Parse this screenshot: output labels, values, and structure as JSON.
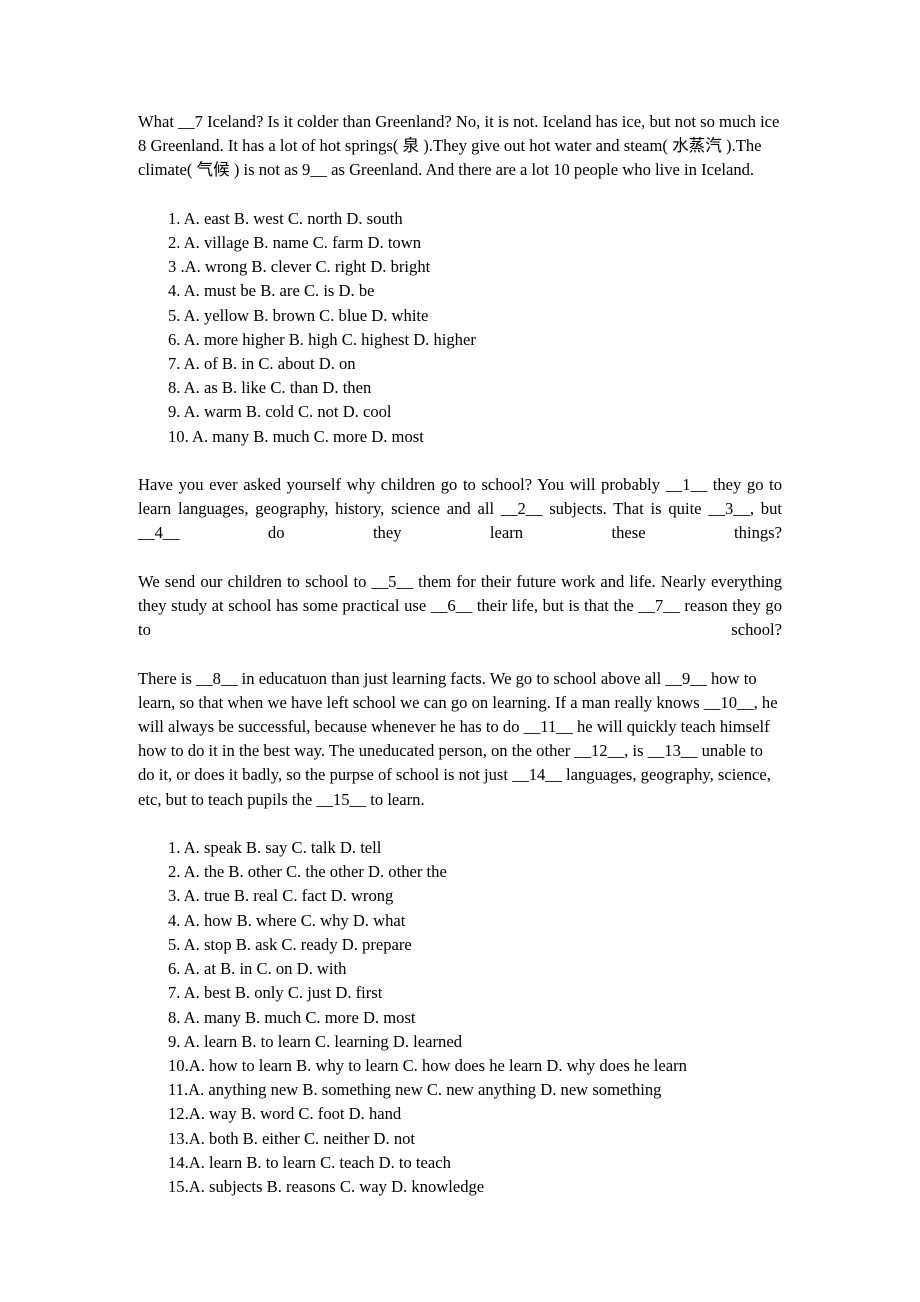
{
  "document": {
    "type": "english-cloze-worksheet",
    "page_background": "#ffffff",
    "text_color": "#000000"
  },
  "passage1": {
    "lines": [
      "What __7 Iceland? Is it colder than Greenland? No, it is not. Iceland has ice, but not so much ice 8 Greenland. It has a lot of hot springs( 泉 ).They give out hot water and steam( 水蒸汽 ).The climate( 气候 ) is not as 9__ as Greenland. And there are a lot 10 people who live in Iceland."
    ],
    "full_text": "What __7 Iceland? Is it colder than Greenland? No, it is not. Iceland has ice, but not so much ice 8 Greenland. It has a lot of hot springs( 泉 ).They give out hot water and steam( 水蒸汽 ).The climate( 气候 ) is not as 9__ as Greenland. And there are a lot 10 people who live in Iceland."
  },
  "passage1_options": [
    "1. A. east B. west C. north D. south",
    "2. A. village B. name C. farm D. town",
    "3 .A. wrong B. clever C. right D. bright",
    "4. A. must be B. are C. is D. be",
    "5. A. yellow B. brown C. blue D. white",
    "6. A. more higher B. high C. highest D. higher",
    "7. A. of B. in C. about D. on",
    "8. A. as B. like C. than D. then",
    "9. A. warm B. cold C. not D. cool",
    "10. A. many B. much C. more D. most"
  ],
  "passage2": {
    "paragraphs": [
      "Have you ever asked yourself why children go to school? You will probably __1__ they go to learn languages, geography, history, science and all __2__ subjects. That is quite __3__, but __4__ do they learn these things?",
      "We send our children to school to __5__ them for their future work and life. Nearly everything they study at school has some practical use __6__ their life, but is that the __7__ reason they go to school?",
      "There is __8__ in educatuon than just learning facts. We go to school above all __9__ how to learn, so that when we have left school we can go on learning. If a man really knows __10__, he will always be successful, because whenever he has to do __11__ he will quickly teach himself how to do it in the best way. The uneducated person, on the other __12__, is __13__ unable to do it, or does it badly, so the purpse of school is not just __14__ languages, geography, science, etc, but to teach pupils the __15__ to learn."
    ]
  },
  "passage2_options": [
    "1. A. speak B. say C. talk D. tell",
    "2. A. the B. other C. the other D. other the",
    "3. A. true B. real C. fact D. wrong",
    "4. A. how B. where C. why D. what",
    "5. A. stop B. ask C. ready D. prepare",
    "6. A. at B. in C. on D. with",
    "7. A. best B. only C. just D. first",
    "8. A. many B. much C. more D. most",
    "9. A. learn B. to learn C. learning D. learned",
    "10.A. how to learn B. why to learn C. how does he learn D. why does he learn",
    "11.A. anything new B. something new C. new anything D. new something",
    "12.A. way B. word C. foot D. hand",
    "13.A. both B. either C. neither D. not",
    "14.A. learn B. to learn C. teach D. to teach",
    "15.A. subjects B. reasons C. way D. knowledge"
  ]
}
